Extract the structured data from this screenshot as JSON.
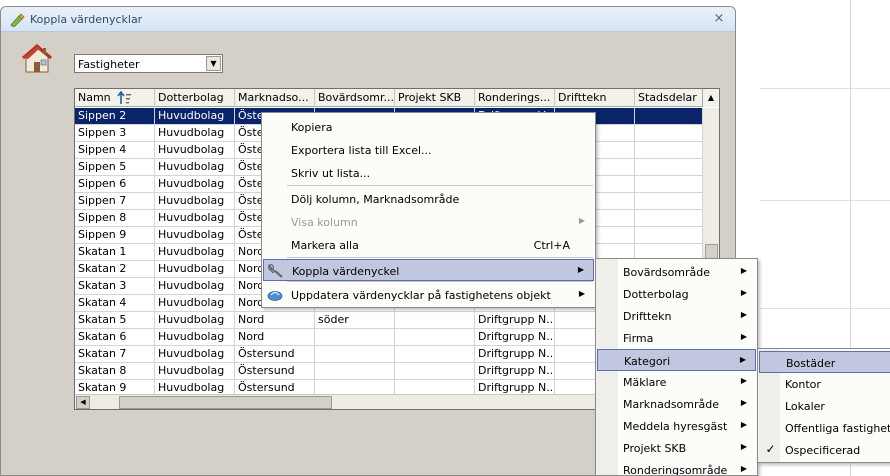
{
  "window": {
    "title": "Koppla värdenycklar",
    "title_icon": "key-pencil-icon",
    "close_glyph": "×"
  },
  "toolbar": {
    "property_icon": "house-icon",
    "combo_value": "Fastigheter"
  },
  "grid": {
    "columns": [
      "Namn",
      "Dotterbolag",
      "Marknadso...",
      "Bovärdsomr...",
      "Projekt SKB",
      "Ronderings...",
      "Drifttekn",
      "Stadsdelar"
    ],
    "rows": [
      [
        "Sippen 2",
        "Huvudbolag",
        "Öster",
        "",
        "",
        "Driftgrupp V...",
        "",
        ""
      ],
      [
        "Sippen 3",
        "Huvudbolag",
        "Öster",
        "",
        "",
        "",
        "",
        ""
      ],
      [
        "Sippen 4",
        "Huvudbolag",
        "Öster",
        "",
        "",
        "",
        "",
        ""
      ],
      [
        "Sippen 5",
        "Huvudbolag",
        "Öster",
        "",
        "",
        "",
        "",
        ""
      ],
      [
        "Sippen 6",
        "Huvudbolag",
        "Öster",
        "",
        "",
        "",
        "",
        ""
      ],
      [
        "Sippen 7",
        "Huvudbolag",
        "Öster",
        "",
        "",
        "",
        "",
        ""
      ],
      [
        "Sippen 8",
        "Huvudbolag",
        "Öster",
        "",
        "",
        "",
        "",
        ""
      ],
      [
        "Sippen 9",
        "Huvudbolag",
        "Öster",
        "",
        "",
        "",
        "",
        ""
      ],
      [
        "Skatan 1",
        "Huvudbolag",
        "Nord",
        "",
        "",
        "",
        "",
        ""
      ],
      [
        "Skatan 2",
        "Huvudbolag",
        "Nord",
        "",
        "",
        "",
        "",
        ""
      ],
      [
        "Skatan 3",
        "Huvudbolag",
        "Nord",
        "",
        "",
        "",
        "",
        ""
      ],
      [
        "Skatan 4",
        "Huvudbolag",
        "Nord",
        "",
        "",
        "",
        "",
        ""
      ],
      [
        "Skatan 5",
        "Huvudbolag",
        "Nord",
        "söder",
        "",
        "Driftgrupp N...",
        "",
        ""
      ],
      [
        "Skatan 6",
        "Huvudbolag",
        "Nord",
        "",
        "",
        "Driftgrupp N...",
        "",
        ""
      ],
      [
        "Skatan 7",
        "Huvudbolag",
        "Östersund",
        "",
        "",
        "Driftgrupp N...",
        "",
        ""
      ],
      [
        "Skatan 8",
        "Huvudbolag",
        "Östersund",
        "",
        "",
        "Driftgrupp N...",
        "",
        ""
      ],
      [
        "Skatan 9",
        "Huvudbolag",
        "Östersund",
        "",
        "",
        "Driftgrupp N...",
        "",
        ""
      ]
    ]
  },
  "context_menu": {
    "items": [
      {
        "label": "Kopiera"
      },
      {
        "label": "Exportera lista till Excel..."
      },
      {
        "label": "Skriv ut lista..."
      },
      {
        "label": "Dölj kolumn, Marknadsområde"
      },
      {
        "label": "Visa kolumn"
      },
      {
        "label": "Markera alla",
        "shortcut": "Ctrl+A"
      },
      {
        "label": "Koppla värdenyckel",
        "icon": "key-wrench-icon"
      },
      {
        "label": "Uppdatera värdenycklar på fastighetens objekt",
        "icon": "update-cloud-icon"
      }
    ],
    "arrow_glyph": "▶"
  },
  "submenu": {
    "items": [
      "Bovärdsområde",
      "Dotterbolag",
      "Drifttekn",
      "Firma",
      "Kategori",
      "Mäklare",
      "Marknadsområde",
      "Meddela hyresgäst",
      "Projekt SKB",
      "Ronderingsområde"
    ]
  },
  "subsubmenu": {
    "items": [
      "Bostäder",
      "Kontor",
      "Lokaler",
      "Offentliga fastigheter",
      "Ospecificerad"
    ],
    "check_glyph": "✓"
  },
  "colors": {
    "selection": "#0a246a",
    "menu_highlight": "#c2c7e0",
    "window_bg": "#d4d0c8"
  }
}
